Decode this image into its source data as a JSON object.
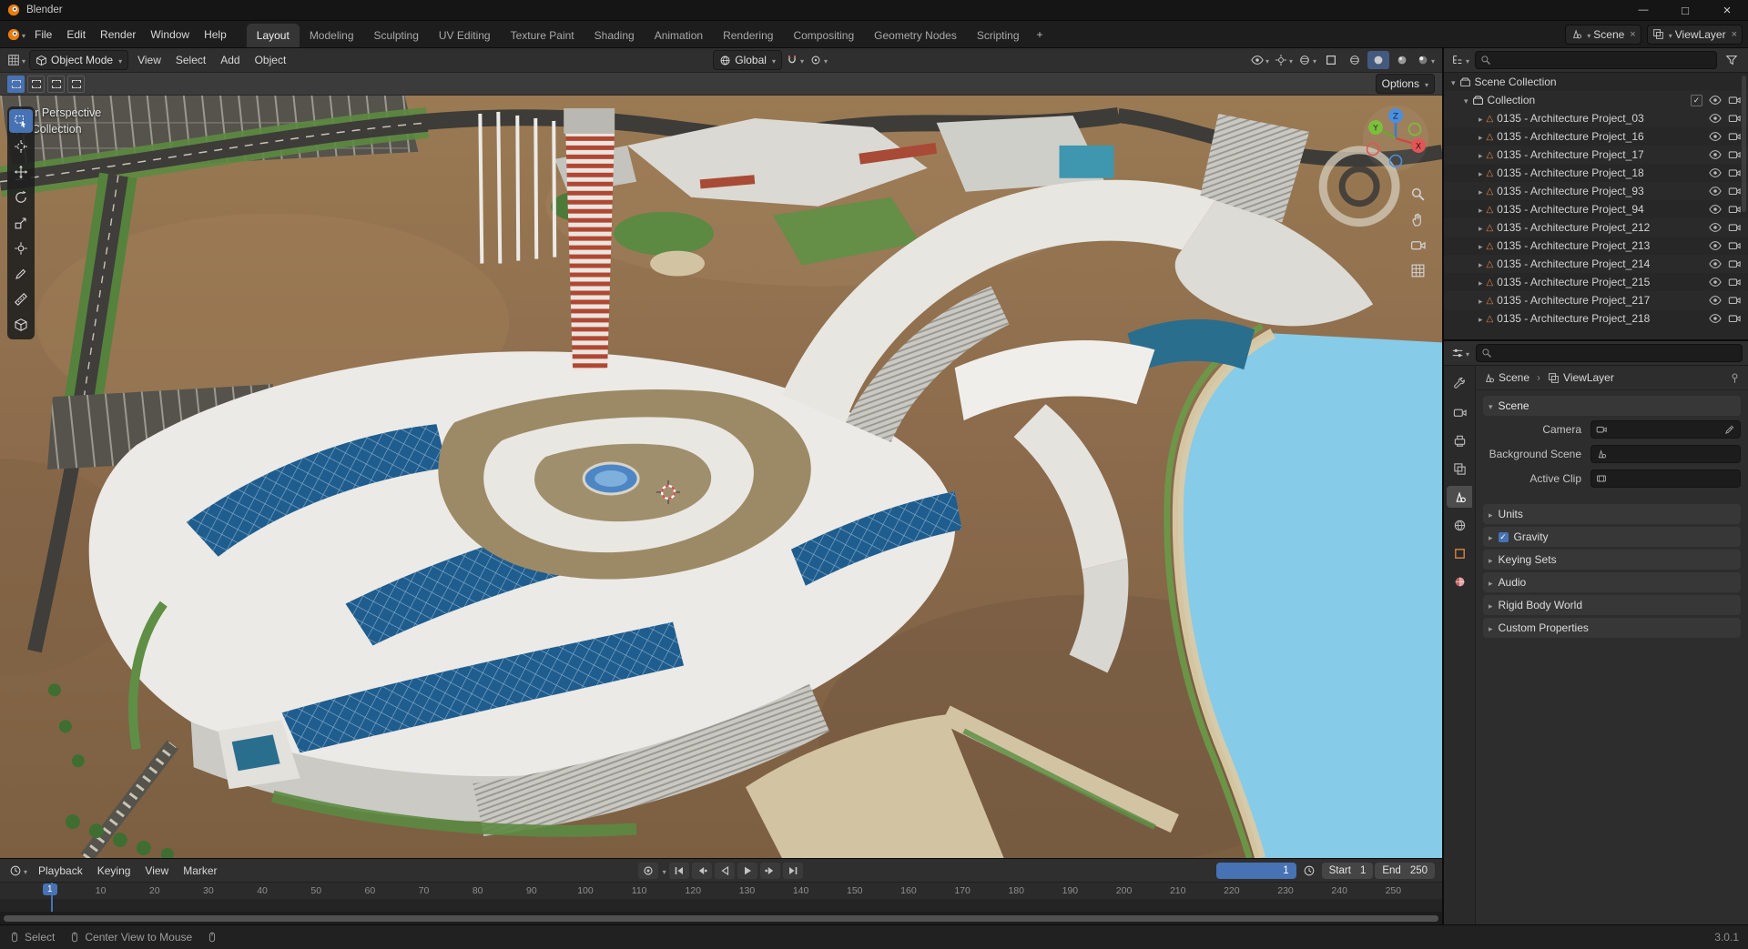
{
  "window": {
    "title": "Blender"
  },
  "topbar": {
    "menus": [
      "File",
      "Edit",
      "Render",
      "Window",
      "Help"
    ],
    "workspaces": [
      {
        "label": "Layout",
        "active": true
      },
      {
        "label": "Modeling"
      },
      {
        "label": "Sculpting"
      },
      {
        "label": "UV Editing"
      },
      {
        "label": "Texture Paint"
      },
      {
        "label": "Shading"
      },
      {
        "label": "Animation"
      },
      {
        "label": "Rendering"
      },
      {
        "label": "Compositing"
      },
      {
        "label": "Geometry Nodes"
      },
      {
        "label": "Scripting"
      }
    ],
    "add_workspace_label": "+",
    "scene": "Scene",
    "view_layer": "ViewLayer"
  },
  "viewport": {
    "header": {
      "mode": "Object Mode",
      "menus": [
        "View",
        "Select",
        "Add",
        "Object"
      ],
      "orientation": "Global",
      "options_label": "Options"
    },
    "overlay": {
      "line1": "User Perspective",
      "line2": "(1) Collection"
    },
    "tools": [
      "box-select-tool",
      "cursor-tool",
      "move-tool",
      "rotate-tool",
      "scale-tool",
      "transform-tool",
      "annotate-tool",
      "measure-tool",
      "add-cube-tool"
    ],
    "gizmo_axes": {
      "x": "X",
      "y": "Y",
      "z": "Z"
    }
  },
  "outliner": {
    "root": "Scene Collection",
    "collection": "Collection",
    "items": [
      "0135 - Architecture Project_03",
      "0135 - Architecture Project_16",
      "0135 - Architecture Project_17",
      "0135 - Architecture Project_18",
      "0135 - Architecture Project_93",
      "0135 - Architecture Project_94",
      "0135 - Architecture Project_212",
      "0135 - Architecture Project_213",
      "0135 - Architecture Project_214",
      "0135 - Architecture Project_215",
      "0135 - Architecture Project_217",
      "0135 - Architecture Project_218"
    ]
  },
  "properties": {
    "breadcrumb": {
      "scene": "Scene",
      "view_layer": "ViewLayer"
    },
    "panel_title": "Scene",
    "fields": [
      {
        "label": "Camera",
        "value": ""
      },
      {
        "label": "Background Scene",
        "value": ""
      },
      {
        "label": "Active Clip",
        "value": ""
      }
    ],
    "sections": [
      {
        "label": "Units"
      },
      {
        "label": "Gravity",
        "checkbox": true
      },
      {
        "label": "Keying Sets"
      },
      {
        "label": "Audio"
      },
      {
        "label": "Rigid Body World"
      },
      {
        "label": "Custom Properties"
      }
    ]
  },
  "timeline": {
    "menus": [
      "Playback",
      "Keying",
      "View",
      "Marker"
    ],
    "current_frame": "1",
    "start_label": "Start",
    "start_value": "1",
    "end_label": "End",
    "end_value": "250",
    "ticks": [
      "10",
      "20",
      "30",
      "40",
      "50",
      "60",
      "70",
      "80",
      "90",
      "100",
      "110",
      "120",
      "130",
      "140",
      "150",
      "160",
      "170",
      "180",
      "190",
      "200",
      "210",
      "220",
      "230",
      "240",
      "250"
    ]
  },
  "statusbar": {
    "select_hint": "Select",
    "center_hint": "Center View to Mouse",
    "version": "3.0.1"
  },
  "colors": {
    "accent": "#4772b3",
    "water": "#86cbe8",
    "terrain": "#8a6a4b",
    "building": "#eceae6",
    "glass": "#1f5d8e"
  }
}
